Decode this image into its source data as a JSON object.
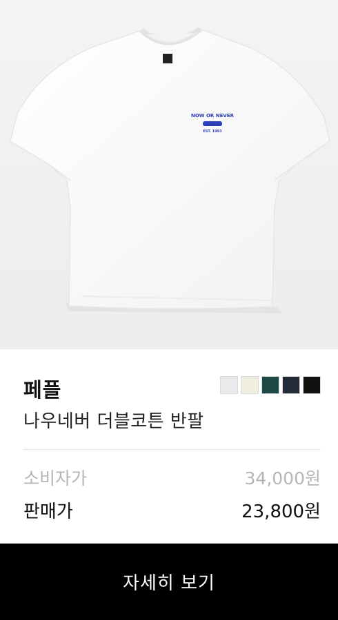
{
  "product": {
    "image_alt": "NOW OR NEVER",
    "tee_print": {
      "arc_text": "NOW OR NEVER",
      "sub_text": "EST. 1993"
    },
    "brand": "페플",
    "name": "나우네버 더블코튼 반팔",
    "colors": [
      "#eaeaea",
      "#f0eedf",
      "#1e4a45",
      "#232a3a",
      "#111111"
    ],
    "msrp_label": "소비자가",
    "msrp_value": "34,000원",
    "sale_label": "판매가",
    "sale_value": "23,800원"
  },
  "actions": {
    "detail_label": "자세히 보기"
  }
}
